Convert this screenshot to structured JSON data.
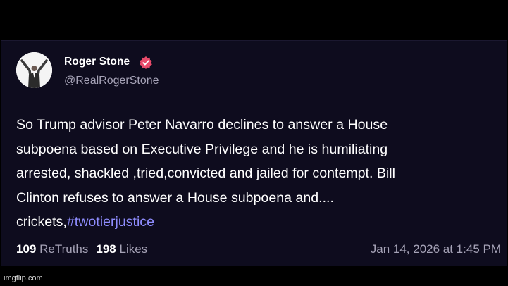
{
  "post": {
    "author": {
      "display_name": "Roger Stone",
      "handle": "@RealRogerStone",
      "verified": true,
      "avatar_icon": "avatar"
    },
    "body_lines": [
      "So Trump advisor Peter Navarro declines to answer a House",
      "subpoena based on Executive Privilege and he is humiliating",
      "arrested, shackled ,tried,convicted  and jailed for contempt. Bill",
      "Clinton refuses to answer a House subpoena and....",
      "crickets,"
    ],
    "hashtag": "#twotierjustice",
    "stats": {
      "retruths_count": "109",
      "retruths_label": "ReTruths",
      "likes_count": "198",
      "likes_label": "Likes"
    },
    "timestamp": "Jan 14, 2026 at 1:45 PM"
  },
  "watermark": "imgflip.com",
  "colors": {
    "background": "#0e0c1e",
    "text": "#ffffff",
    "muted": "#a5a2b6",
    "hashtag": "#8f8dff",
    "verified_badge": "#e84a6a"
  }
}
